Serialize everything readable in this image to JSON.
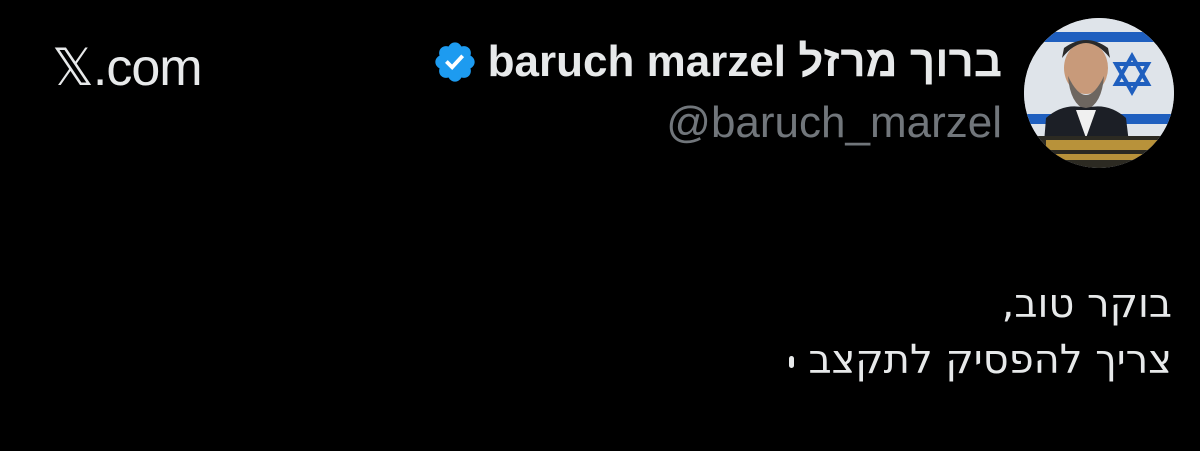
{
  "site": {
    "x_glyph": "𝕏",
    "domain": ".com"
  },
  "author": {
    "display_name": "baruch marzel ברוך מרזל",
    "handle": "@baruch_marzel",
    "verified": true,
    "verified_color": "#1d9bf0"
  },
  "tweet": {
    "lines": [
      "בוקר טוב,",
      "צריך להפסיק לתקצב"
    ]
  },
  "colors": {
    "background": "#000000",
    "primary_text": "#e7e9ea",
    "secondary_text": "#71767b"
  }
}
